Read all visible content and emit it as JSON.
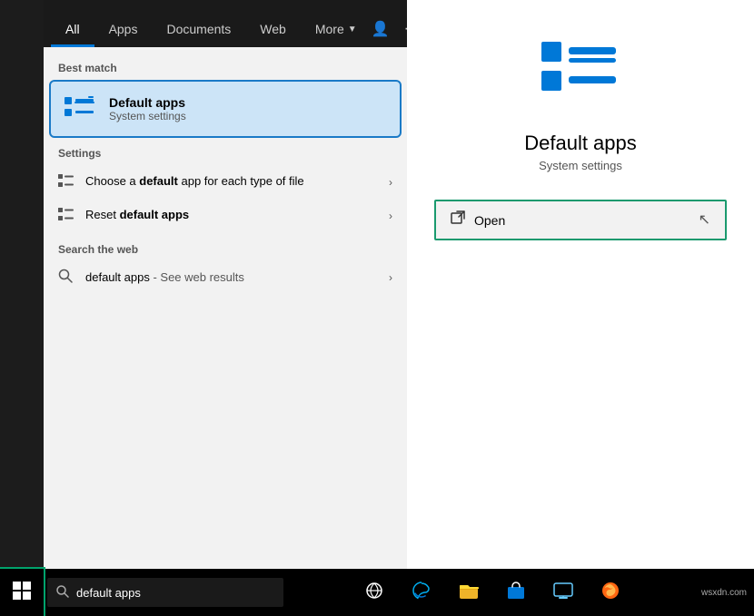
{
  "nav": {
    "tabs": [
      {
        "label": "All",
        "active": true
      },
      {
        "label": "Apps",
        "active": false
      },
      {
        "label": "Documents",
        "active": false
      },
      {
        "label": "Web",
        "active": false
      },
      {
        "label": "More",
        "active": false,
        "hasArrow": true
      }
    ],
    "icons": {
      "person": "👤",
      "more": "···"
    }
  },
  "results": {
    "bestMatch": {
      "label": "Best match",
      "title": "Default apps",
      "subtitle": "System settings"
    },
    "settings": {
      "label": "Settings",
      "items": [
        {
          "text_before": "Choose a ",
          "bold": "default",
          "text_after": " app for each type of file",
          "arrow": "›"
        },
        {
          "text_before": "Reset ",
          "bold": "default apps",
          "text_after": "",
          "arrow": "›"
        }
      ]
    },
    "webSearch": {
      "label": "Search the web",
      "query": "default apps",
      "suffix": " - See web results",
      "arrow": "›"
    }
  },
  "appDetail": {
    "name": "Default apps",
    "subtitle": "System settings",
    "openButton": "Open"
  },
  "taskbar": {
    "searchText": "default apps",
    "searchPlaceholder": "default apps",
    "buttons": [
      "⊞",
      "🔍",
      "🌐",
      "📁",
      "🛍️",
      "💻",
      "🦊"
    ]
  }
}
